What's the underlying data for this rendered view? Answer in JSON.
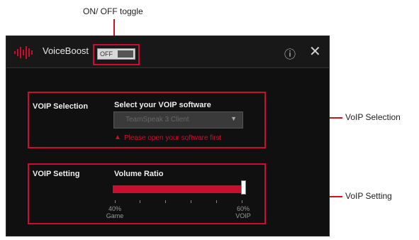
{
  "callouts": {
    "toggle": "ON/ OFF toggle",
    "voip_selection": "VoIP Selection",
    "voip_setting": "VoIP Setting"
  },
  "app": {
    "title": "VoiceBoost",
    "logo_icon": "voiceboost-waveform-icon",
    "toggle_state": "OFF",
    "info_icon": "info-icon",
    "close_icon": "close-icon"
  },
  "voip_selection": {
    "section_title": "VOIP Selection",
    "prompt": "Select your VOIP software",
    "dropdown_value": "TeamSpeak 3 Client",
    "warning_icon": "warning-triangle-icon",
    "warning_text": "Please open your software first"
  },
  "voip_setting": {
    "section_title": "VOIP Setting",
    "label": "Volume Ratio",
    "slider_value": 1.0,
    "min_label_pct": "40%",
    "min_label": "Game",
    "max_label_pct": "60%",
    "max_label": "VOIP"
  },
  "colors": {
    "accent": "#c8102e",
    "background": "#101010"
  }
}
